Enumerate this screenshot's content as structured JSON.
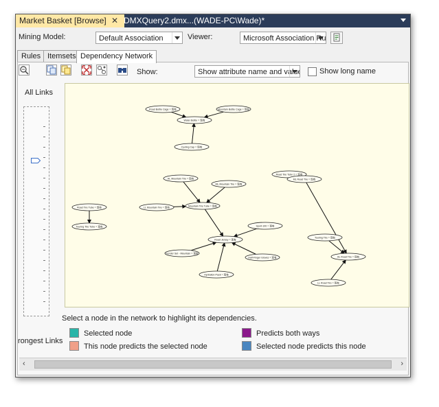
{
  "tabs": {
    "active": "Market Basket [Browse]",
    "close": "✕",
    "inactive": "DMXQuery2.dmx...(WADE-PC\\Wade)*"
  },
  "toolbar": {
    "mining_model_label": "Mining Model:",
    "mining_model_value": "Default Association",
    "viewer_label": "Viewer:",
    "viewer_value": "Microsoft Association Ru",
    "show_label": "Show:",
    "show_value": "Show attribute name and value",
    "long_name_label": "Show long name"
  },
  "view_tabs": [
    "Rules",
    "Itemsets",
    "Dependency Network"
  ],
  "slider": {
    "top_label": "All Links",
    "bottom_label": "rongest Links"
  },
  "network": {
    "nodes": [
      "Road Bottle Cage = 现有",
      "Water Bottle = 现有",
      "Mountain Bottle Cage = 现有",
      "Cycling Cap = 现有",
      "HL Mountain Tire = 现有",
      "ML Mountain Tire = 现有",
      "LL Mountain Tire = 现有",
      "Mountain Tire Tube = 现有",
      "Road Tire Tube = 现有",
      "Touring Tire Tube = 现有",
      "Sport-100 = 现有",
      "Fender Set - Mountain = 现有",
      "Half-Finger Gloves = 现有",
      "Road Jersey = 现有",
      "Hydration Pack = 现有",
      "Touring Tire = 现有",
      "HL Road Tire = 现有",
      "LL Road Tire = 现有",
      "Road Tire Tube 2 = 现有",
      "ML Road Tire = 现有"
    ]
  },
  "status_text": "Select a node in the network to highlight its dependencies.",
  "legend": {
    "selected": "Selected node",
    "predicts_both": "Predicts both ways",
    "predicts_selected": "This node predicts the selected node",
    "selected_predicts": "Selected node predicts this node"
  },
  "colors": {
    "selected": "#2ab5a8",
    "predicts_both": "#8b1a8b",
    "predicts_selected": "#f0a088",
    "selected_predicts": "#4a86c0",
    "graph_bg": "#fffde8",
    "tab_bar": "#2b3c59",
    "active_tab": "#ffe8a6"
  },
  "icons": [
    "zoom-out-icon",
    "copy-icon",
    "copy-selection-icon",
    "fit-to-window-icon",
    "layout-icon",
    "find-node-icon",
    "refresh-icon"
  ]
}
